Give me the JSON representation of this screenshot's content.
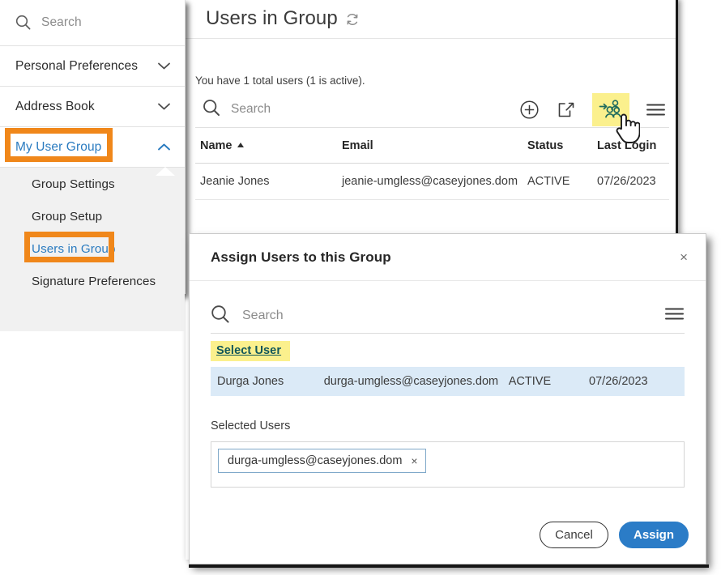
{
  "sidebar": {
    "search": {
      "placeholder": "Search",
      "icon": "search-icon"
    },
    "groups": [
      {
        "label": "Personal Preferences",
        "chevron": "chevron-down-icon",
        "expanded": false,
        "highlighted": false
      },
      {
        "label": "Address Book",
        "chevron": "chevron-down-icon",
        "expanded": false,
        "highlighted": false
      },
      {
        "label": "My User Group",
        "chevron": "chevron-up-icon",
        "expanded": true,
        "highlighted": true
      }
    ],
    "submenu": [
      {
        "label": "Group Settings",
        "active": false
      },
      {
        "label": "Group Setup",
        "active": false
      },
      {
        "label": "Users in Group",
        "active": true
      },
      {
        "label": "Signature Preferences",
        "active": false
      }
    ]
  },
  "main": {
    "page_title": "Users in Group",
    "refresh_icon": "refresh-icon",
    "summary": "You have 1 total users (1 is active).",
    "search": {
      "placeholder": "Search",
      "icon": "search-icon"
    },
    "actions": [
      {
        "name": "add-icon",
        "label": "Add"
      },
      {
        "name": "export-icon",
        "label": "Export"
      },
      {
        "name": "assign-users-icon",
        "label": "Assign Users",
        "highlighted": true
      },
      {
        "name": "menu-icon",
        "label": "Menu"
      }
    ],
    "table": {
      "columns": [
        "Name",
        "Email",
        "Status",
        "Last Login"
      ],
      "sorted_column": "Name",
      "sort_direction": "asc",
      "rows": [
        {
          "name": "Jeanie Jones",
          "email": "jeanie-umgless@caseyjones.dom",
          "status": "ACTIVE",
          "last_login": "07/26/2023"
        }
      ]
    }
  },
  "modal": {
    "title": "Assign Users to this Group",
    "close_label": "×",
    "search": {
      "placeholder": "Search",
      "icon": "search-icon"
    },
    "menu_icon": "menu-icon",
    "select_user_link": "Select User",
    "results": [
      {
        "name": "Durga Jones",
        "email": "durga-umgless@caseyjones.dom",
        "status": "ACTIVE",
        "last_login": "07/26/2023",
        "selected": true
      }
    ],
    "selected_users_label": "Selected Users",
    "chips": [
      {
        "text": "durga-umgless@caseyjones.dom",
        "remove_label": "×"
      }
    ],
    "cancel_label": "Cancel",
    "assign_label": "Assign"
  },
  "colors": {
    "annotation_orange": "#f0871a",
    "highlight_yellow": "#fbf08d",
    "link_blue": "#2a7bc0",
    "assign_blue": "#2b7cc7",
    "teal_link": "#10565a",
    "row_selected_blue": "#dbeaf7",
    "submenu_gray": "#f1f1f1"
  }
}
